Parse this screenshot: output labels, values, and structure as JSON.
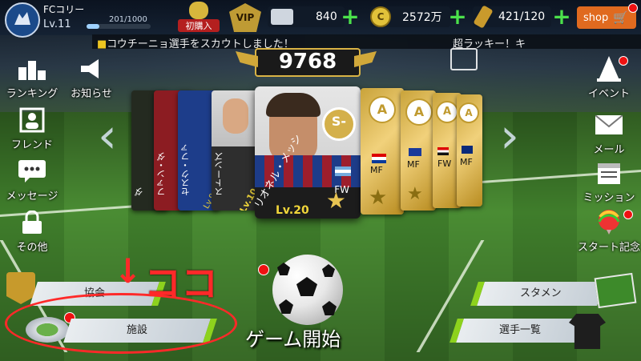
{
  "header": {
    "club_name": "FCコリー",
    "level": "Lv.11",
    "xp_text": "201/1000",
    "xp_progress": 0.201,
    "first_purchase_label": "初購入",
    "vip_label": "VIP",
    "tickets": "840",
    "coins": "2572万",
    "stamina": "421/120",
    "shop_label": "shop"
  },
  "ticker": {
    "message": "コウチーニョ選手をスカウトしました！",
    "message2": "超ラッキー！キ"
  },
  "score": "9768",
  "left_menu": [
    {
      "label": "ランキング",
      "icon": "podium-icon"
    },
    {
      "label": "お知らせ",
      "icon": "megaphone-icon"
    },
    {
      "label": "フレンド",
      "icon": "friend-icon"
    },
    {
      "label": "メッセージ",
      "icon": "message-icon"
    },
    {
      "label": "その他",
      "icon": "lock-icon"
    }
  ],
  "right_menu": [
    {
      "label": "イベント",
      "icon": "cone-icon"
    },
    {
      "label": "メール",
      "icon": "mail-icon"
    },
    {
      "label": "ミッション",
      "icon": "calendar-icon"
    },
    {
      "label": "スタート記念",
      "icon": "balloon-icon"
    }
  ],
  "cards": {
    "main": {
      "rank": "S-",
      "name": "リオネル・メッシ",
      "level": "Lv.20",
      "position": "FW"
    },
    "left": [
      {
        "name": "ストーンズ",
        "level": "Lv.10"
      },
      {
        "name": "セスク・ファ",
        "level": "Lv.9"
      },
      {
        "name": "ファン・ダ",
        "level": ""
      },
      {
        "name": "ダ",
        "level": ""
      }
    ],
    "right": [
      {
        "rank": "A",
        "position": "MF"
      },
      {
        "rank": "A",
        "position": "MF"
      },
      {
        "rank": "A",
        "position": "FW"
      },
      {
        "rank": "A",
        "position": "MF"
      }
    ]
  },
  "buttons": {
    "association": "協会",
    "facility": "施設",
    "lineup": "スタメン",
    "player_list": "選手一覧",
    "start_game": "ゲーム開始"
  },
  "annotation": {
    "koko": "ココ",
    "arrow": "↓"
  },
  "colors": {
    "accent_green": "#8dd21d",
    "shop_orange": "#e06a1f",
    "annotation_red": "#ff2929",
    "gold": "#d4b04a"
  }
}
